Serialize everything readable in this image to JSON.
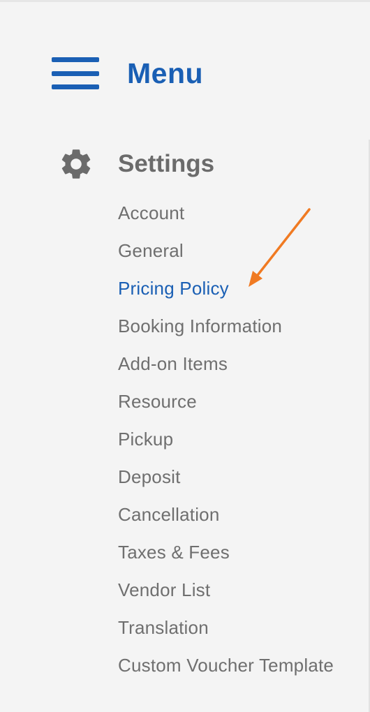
{
  "colors": {
    "accent": "#1a5fb4",
    "text_gray": "#6f6f6f",
    "heading_gray": "#6b6b6b",
    "background": "#f4f4f4",
    "annotation_arrow": "#f07a22"
  },
  "menu": {
    "title": "Menu",
    "icon": "hamburger-icon"
  },
  "settings": {
    "title": "Settings",
    "icon": "gear-icon",
    "selected": "Pricing Policy",
    "items": [
      {
        "label": "Account"
      },
      {
        "label": "General"
      },
      {
        "label": "Pricing Policy"
      },
      {
        "label": "Booking Information"
      },
      {
        "label": "Add-on Items"
      },
      {
        "label": "Resource"
      },
      {
        "label": "Pickup"
      },
      {
        "label": "Deposit"
      },
      {
        "label": "Cancellation"
      },
      {
        "label": "Taxes & Fees"
      },
      {
        "label": "Vendor List"
      },
      {
        "label": "Translation"
      },
      {
        "label": "Custom Voucher Template"
      }
    ]
  },
  "annotation": {
    "type": "arrow",
    "points_to": "Pricing Policy"
  }
}
